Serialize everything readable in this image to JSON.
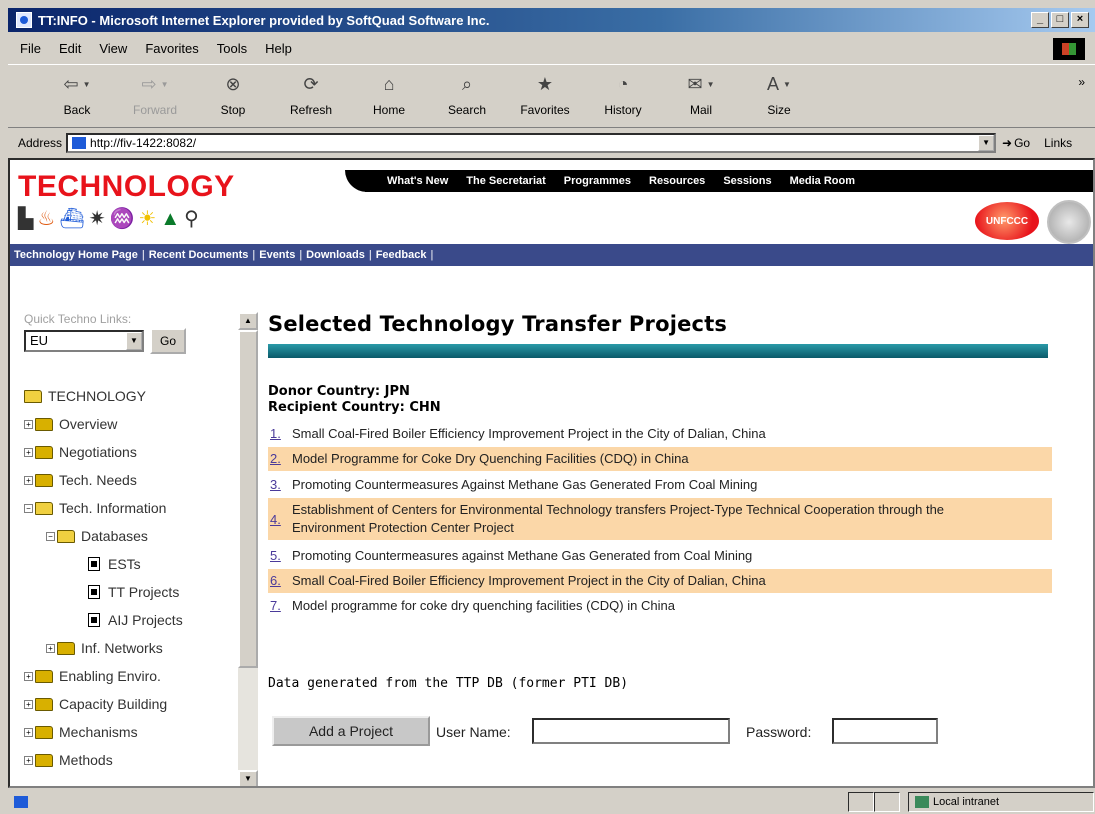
{
  "window": {
    "title": "TT:INFO - Microsoft Internet Explorer provided by SoftQuad Software Inc.",
    "minimize": "_",
    "maximize": "□",
    "close": "×"
  },
  "menu": [
    "File",
    "Edit",
    "View",
    "Favorites",
    "Tools",
    "Help"
  ],
  "toolbar": {
    "back": "Back",
    "forward": "Forward",
    "stop": "Stop",
    "refresh": "Refresh",
    "home": "Home",
    "search": "Search",
    "favorites": "Favorites",
    "history": "History",
    "mail": "Mail",
    "size": "Size",
    "more": "»"
  },
  "address": {
    "label": "Address",
    "url": "http://fiv-1422:8082/",
    "go": "Go",
    "links": "Links"
  },
  "banner": {
    "logo": "TECHNOLOGY",
    "top_nav": [
      "What's New",
      "The Secretariat",
      "Programmes",
      "Resources",
      "Sessions",
      "Media Room"
    ],
    "unfccc": "UNFCCC"
  },
  "subnav": [
    "Technology Home Page",
    "Recent Documents",
    "Events",
    "Downloads",
    "Feedback"
  ],
  "sidebar": {
    "quick_label": "Quick Techno Links:",
    "quick_value": "EU",
    "go": "Go",
    "tree": {
      "root": "TECHNOLOGY",
      "overview": "Overview",
      "negotiations": "Negotiations",
      "tech_needs": "Tech. Needs",
      "tech_info": "Tech. Information",
      "databases": "Databases",
      "ests": "ESTs",
      "tt_projects": "TT Projects",
      "aij_projects": "AIJ Projects",
      "inf_networks": "Inf. Networks",
      "enabling": "Enabling Enviro.",
      "capacity": "Capacity Building",
      "mechanisms": "Mechanisms",
      "methods": "Methods"
    }
  },
  "main": {
    "heading": "Selected Technology Transfer Projects",
    "donor": "Donor Country: JPN",
    "recipient": "Recipient Country: CHN",
    "projects": [
      {
        "num": "1.",
        "title": "Small Coal-Fired Boiler Efficiency Improvement Project in the City of Dalian, China"
      },
      {
        "num": "2.",
        "title": "Model Programme for Coke Dry Quenching Facilities (CDQ) in China"
      },
      {
        "num": "3.",
        "title": "Promoting Countermeasures Against Methane Gas Generated From Coal Mining"
      },
      {
        "num": "4.",
        "title": "Establishment of Centers for Environmental Technology transfers Project-Type Technical Cooperation through the Environment Protection Center Project"
      },
      {
        "num": "5.",
        "title": "Promoting Countermeasures against Methane Gas Generated from Coal Mining"
      },
      {
        "num": "6.",
        "title": "Small Coal-Fired Boiler Efficiency Improvement Project in the City of Dalian, China"
      },
      {
        "num": "7.",
        "title": "Model programme for coke dry quenching facilities (CDQ) in China"
      }
    ],
    "generated": "Data generated from the TTP DB (former PTI DB)",
    "add_button": "Add a Project",
    "username_label": "User Name:",
    "password_label": "Password:"
  },
  "status": {
    "zone": "Local intranet"
  }
}
